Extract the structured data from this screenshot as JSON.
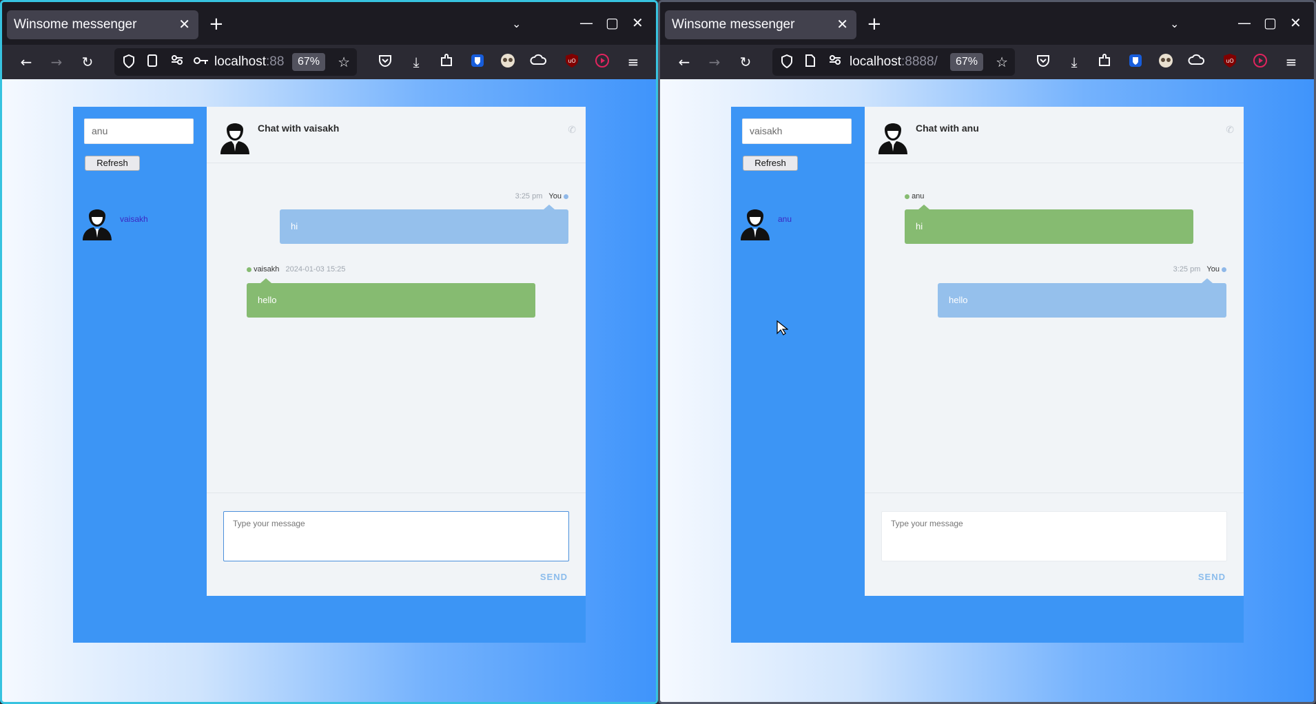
{
  "windows": [
    {
      "id": "left",
      "tab": {
        "title": "Winsome messenger",
        "close": "✕"
      },
      "url": {
        "host": "localhost",
        "rest": ":88",
        "zoom": "67%"
      },
      "search_value": "anu",
      "refresh_label": "Refresh",
      "contact": {
        "name": "vaisakh"
      },
      "chat_title": "Chat with vaisakh",
      "messages": [
        {
          "direction": "out",
          "time": "3:25 pm",
          "sender": "You",
          "text": "hi"
        },
        {
          "direction": "in",
          "sender": "vaisakh",
          "time": "2024-01-03 15:25",
          "text": "hello"
        }
      ],
      "composer": {
        "placeholder": "Type your message",
        "send_label": "SEND"
      }
    },
    {
      "id": "right",
      "tab": {
        "title": "Winsome messenger",
        "close": "✕"
      },
      "url": {
        "host": "localhost",
        "rest": ":8888/",
        "zoom": "67%"
      },
      "search_value": "vaisakh",
      "refresh_label": "Refresh",
      "contact": {
        "name": "anu"
      },
      "chat_title": "Chat with anu",
      "messages": [
        {
          "direction": "in",
          "sender": "anu",
          "time": "",
          "text": "hi"
        },
        {
          "direction": "out",
          "time": "3:25 pm",
          "sender": "You",
          "text": "hello"
        }
      ],
      "composer": {
        "placeholder": "Type your message",
        "send_label": "SEND"
      }
    }
  ],
  "colors": {
    "sidebar": "#3c95f5",
    "chat_bg": "#f1f4f7",
    "outgoing_bubble": "#95c0ec",
    "incoming_bubble": "#86bb71",
    "online_dot": "#86bb71",
    "self_dot": "#8fb8e8",
    "contact_link": "#3b27c2"
  },
  "icons": {
    "back": "←",
    "forward": "→",
    "reload": "↻",
    "star": "☆",
    "download": "⤓",
    "menu": "≡",
    "phone": "✆",
    "newtab": "+",
    "tablist": "⌄",
    "minimize": "—",
    "maximize": "▢",
    "close": "✕"
  }
}
